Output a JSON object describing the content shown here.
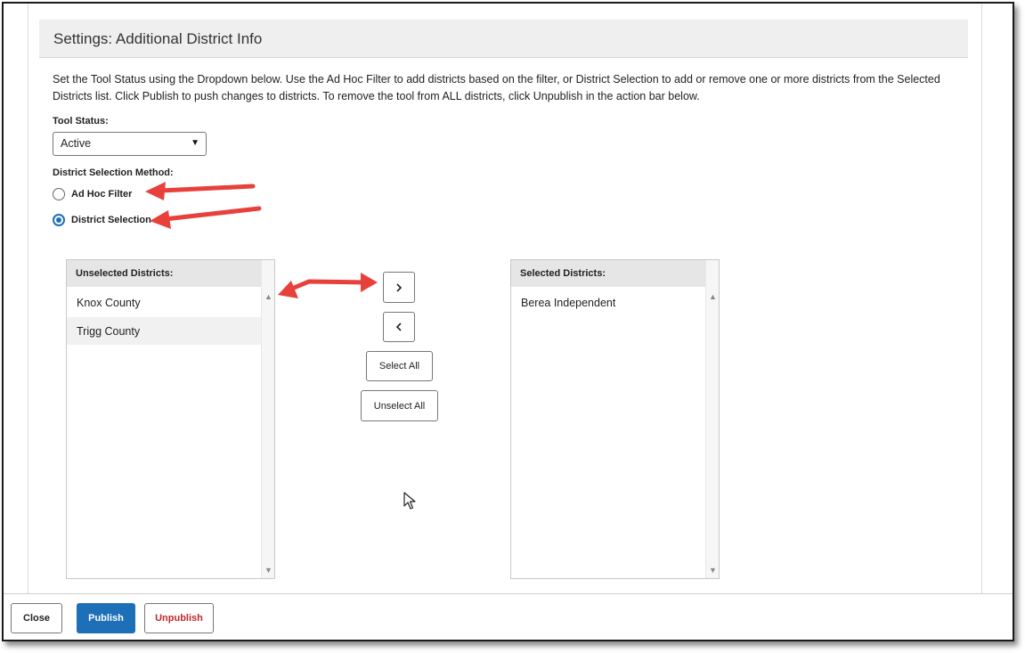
{
  "header": {
    "title": "Settings: Additional District Info"
  },
  "instructions": "Set the Tool Status using the Dropdown below. Use the Ad Hoc Filter to add districts based on the filter, or District Selection to add or remove one or more districts from the Selected Districts list. Click Publish to push changes to districts. To remove the tool from ALL districts, click Unpublish in the action bar below.",
  "tool_status": {
    "label": "Tool Status:",
    "value": "Active",
    "caret_icon": "dropdown-caret-icon"
  },
  "selection_method": {
    "label": "District Selection Method:",
    "options": [
      {
        "label": "Ad Hoc Filter",
        "checked": false
      },
      {
        "label": "District Selection",
        "checked": true
      }
    ]
  },
  "unselected": {
    "header": "Unselected Districts:",
    "items": [
      "Knox County",
      "Trigg County"
    ]
  },
  "selected": {
    "header": "Selected Districts:",
    "items": [
      "Berea Independent"
    ]
  },
  "transfer_buttons": {
    "move_right_icon": "chevron-right-icon",
    "move_left_icon": "chevron-left-icon",
    "select_all": "Select All",
    "unselect_all": "Unselect All"
  },
  "footer": {
    "close": "Close",
    "publish": "Publish",
    "unpublish": "Unpublish"
  },
  "colors": {
    "primary": "#1d6fb8",
    "danger": "#c0282d",
    "annotation_arrow": "#e8413b",
    "header_bg": "#efefef"
  }
}
